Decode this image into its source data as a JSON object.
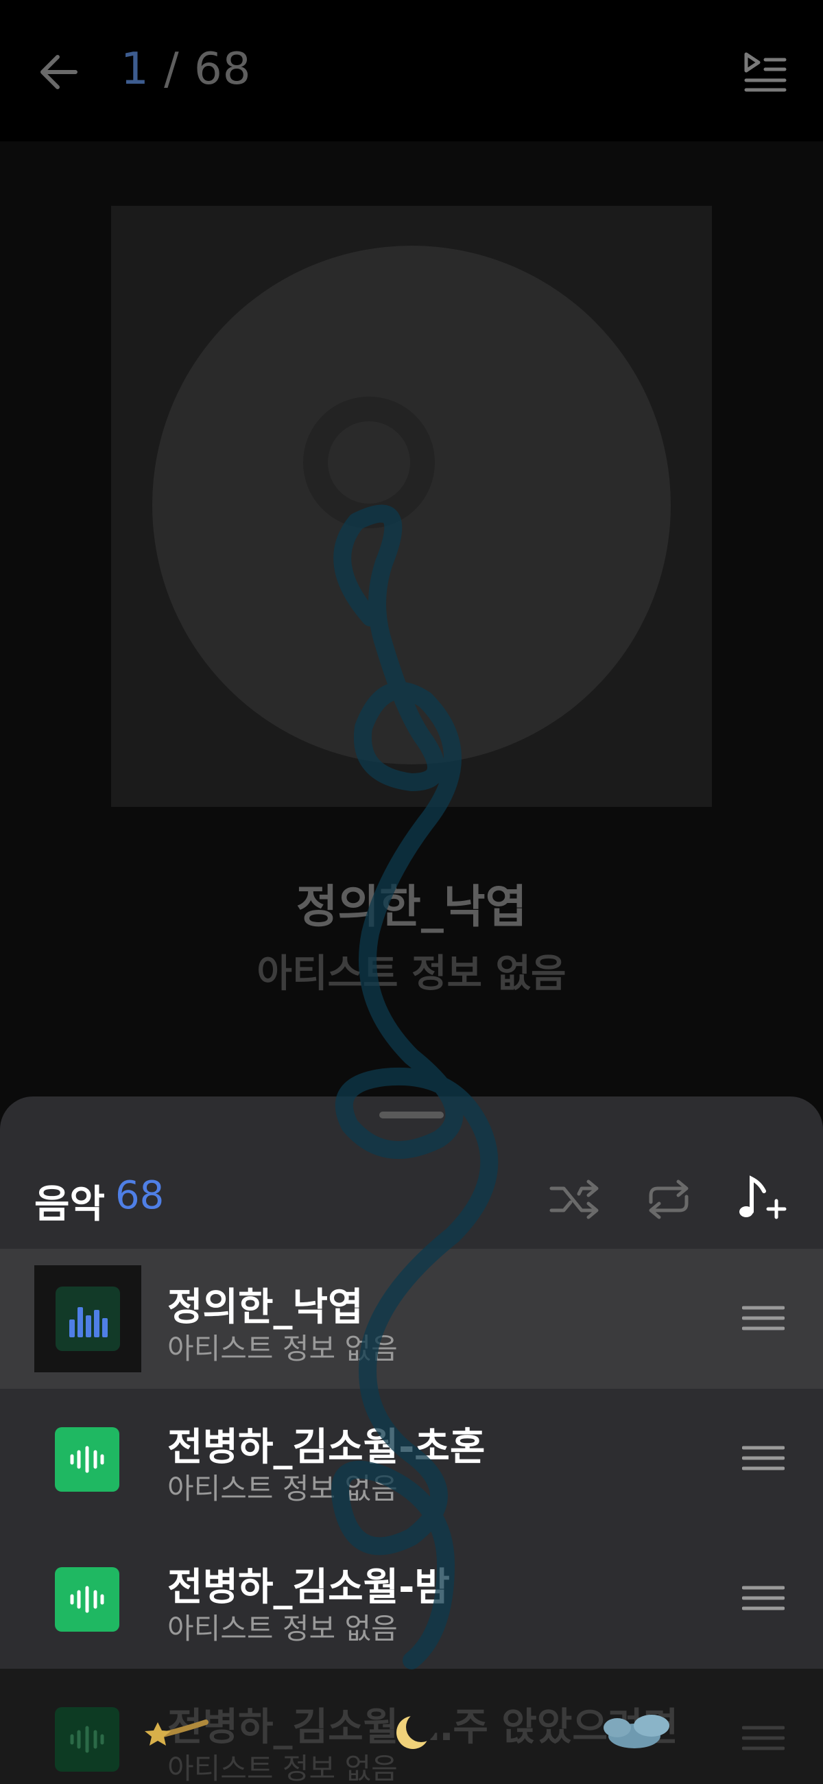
{
  "header": {
    "current_index": "1",
    "separator": " / ",
    "total": "68"
  },
  "now_playing": {
    "title": "정의한_낙엽",
    "artist": "아티스트 정보 없음"
  },
  "playlist": {
    "title": "음악",
    "count": "68",
    "items": [
      {
        "title": "정의한_낙엽",
        "artist": "아티스트 정보 없음",
        "state": "playing"
      },
      {
        "title": "전병하_김소월-초혼",
        "artist": "아티스트 정보 없음",
        "state": "normal"
      },
      {
        "title": "전병하_김소월-밤",
        "artist": "아티스트 정보 없음",
        "state": "normal"
      },
      {
        "title": "전병하_김소월-…주 앉았으려면",
        "artist": "아티스트 정보 없음",
        "state": "dimmed"
      }
    ]
  },
  "icons": {
    "back": "back-arrow-icon",
    "queue": "play-queue-icon",
    "shuffle": "shuffle-icon",
    "repeat": "repeat-icon",
    "add_music": "add-music-icon",
    "drag": "drag-handle-icon"
  },
  "colors": {
    "accent": "#4f7fe6",
    "thumb_green": "#1fb862",
    "sheet_bg": "#2d2d30"
  }
}
